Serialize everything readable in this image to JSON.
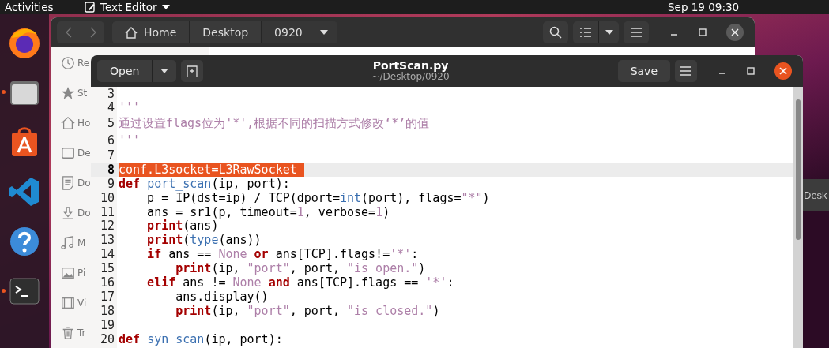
{
  "top_bar": {
    "activities": "Activities",
    "app_menu": "Text Editor",
    "clock": "Sep 19  09:30"
  },
  "dock": [
    {
      "kind": "browser",
      "running": false
    },
    {
      "kind": "files",
      "running": true
    },
    {
      "kind": "software",
      "running": false
    },
    {
      "kind": "code",
      "running": false
    },
    {
      "kind": "help",
      "running": false
    },
    {
      "kind": "terminal",
      "running": true
    }
  ],
  "file_manager": {
    "path": [
      {
        "label": "Home",
        "kind": "home",
        "selected": false
      },
      {
        "label": "Desktop",
        "kind": "folder",
        "selected": false
      },
      {
        "label": "0920",
        "kind": "folder",
        "selected": true
      }
    ],
    "sidebar": [
      {
        "label": "Re",
        "kind": "recent"
      },
      {
        "label": "St",
        "kind": "starred"
      },
      {
        "label": "Ho",
        "kind": "home"
      },
      {
        "label": "De",
        "kind": "desktop"
      },
      {
        "label": "Do",
        "kind": "documents"
      },
      {
        "label": "Do",
        "kind": "downloads"
      },
      {
        "label": "M",
        "kind": "music"
      },
      {
        "label": "Pi",
        "kind": "pictures"
      },
      {
        "label": "Vi",
        "kind": "videos"
      },
      {
        "label": "Tr",
        "kind": "trash"
      }
    ]
  },
  "editor": {
    "open_button": "Open",
    "title": "PortScan.py",
    "subtitle": "~/Desktop/0920",
    "save_button": "Save",
    "lines": [
      {
        "n": "3",
        "current": false
      },
      {
        "n": "4",
        "current": false,
        "tokens": [
          {
            "text": "'''",
            "kind": "string"
          }
        ]
      },
      {
        "n": "5",
        "current": false,
        "tokens": [
          {
            "text": "通过设置flags位为'*',根据不同的扫描方式修改‘*’的值",
            "kind": "string"
          }
        ]
      },
      {
        "n": "6",
        "current": false,
        "tokens": [
          {
            "text": "'''",
            "kind": "string"
          }
        ]
      },
      {
        "n": "7",
        "current": false
      },
      {
        "n": "8",
        "current": true,
        "tokens": [
          {
            "text": "conf.L3socket=L3RawSocket ",
            "kind": "selected"
          }
        ]
      },
      {
        "n": "9",
        "current": false,
        "tokens": [
          {
            "text": "def ",
            "kind": "keyword"
          },
          {
            "text": "port_scan",
            "kind": "function"
          },
          {
            "text": "(ip, port):",
            "kind": "plain"
          }
        ]
      },
      {
        "n": "10",
        "current": false,
        "tokens": [
          {
            "text": "    p = IP(dst=ip) / TCP(dport=",
            "kind": "plain"
          },
          {
            "text": "int",
            "kind": "builtin"
          },
          {
            "text": "(port), flags=",
            "kind": "plain"
          },
          {
            "text": "\"*\"",
            "kind": "string"
          },
          {
            "text": ")",
            "kind": "plain"
          }
        ]
      },
      {
        "n": "11",
        "current": false,
        "tokens": [
          {
            "text": "    ans = sr1(p, timeout=",
            "kind": "plain"
          },
          {
            "text": "1",
            "kind": "number"
          },
          {
            "text": ", verbose=",
            "kind": "plain"
          },
          {
            "text": "1",
            "kind": "number"
          },
          {
            "text": ")",
            "kind": "plain"
          }
        ]
      },
      {
        "n": "12",
        "current": false,
        "tokens": [
          {
            "text": "    print",
            "kind": "keyword"
          },
          {
            "text": "(ans)",
            "kind": "plain"
          }
        ]
      },
      {
        "n": "13",
        "current": false,
        "tokens": [
          {
            "text": "    print",
            "kind": "keyword"
          },
          {
            "text": "(",
            "kind": "plain"
          },
          {
            "text": "type",
            "kind": "builtin"
          },
          {
            "text": "(ans))",
            "kind": "plain"
          }
        ]
      },
      {
        "n": "14",
        "current": false,
        "tokens": [
          {
            "text": "    if",
            "kind": "keyword"
          },
          {
            "text": " ans == ",
            "kind": "plain"
          },
          {
            "text": "None",
            "kind": "number"
          },
          {
            "text": " or",
            "kind": "keyword"
          },
          {
            "text": " ans[TCP].flags!=",
            "kind": "plain"
          },
          {
            "text": "'*'",
            "kind": "string"
          },
          {
            "text": ":",
            "kind": "plain"
          }
        ]
      },
      {
        "n": "15",
        "current": false,
        "tokens": [
          {
            "text": "        print",
            "kind": "keyword"
          },
          {
            "text": "(ip, ",
            "kind": "plain"
          },
          {
            "text": "\"port\"",
            "kind": "string"
          },
          {
            "text": ", port, ",
            "kind": "plain"
          },
          {
            "text": "\"is open.\"",
            "kind": "string"
          },
          {
            "text": ")",
            "kind": "plain"
          }
        ]
      },
      {
        "n": "16",
        "current": false,
        "tokens": [
          {
            "text": "    elif",
            "kind": "keyword"
          },
          {
            "text": " ans != ",
            "kind": "plain"
          },
          {
            "text": "None",
            "kind": "number"
          },
          {
            "text": " and",
            "kind": "keyword"
          },
          {
            "text": " ans[TCP].flags == ",
            "kind": "plain"
          },
          {
            "text": "'*'",
            "kind": "string"
          },
          {
            "text": ":",
            "kind": "plain"
          }
        ]
      },
      {
        "n": "17",
        "current": false,
        "tokens": [
          {
            "text": "        ans.display()",
            "kind": "plain"
          }
        ]
      },
      {
        "n": "18",
        "current": false,
        "tokens": [
          {
            "text": "        print",
            "kind": "keyword"
          },
          {
            "text": "(ip, ",
            "kind": "plain"
          },
          {
            "text": "\"port\"",
            "kind": "string"
          },
          {
            "text": ", port, ",
            "kind": "plain"
          },
          {
            "text": "\"is closed.\"",
            "kind": "string"
          },
          {
            "text": ")",
            "kind": "plain"
          }
        ]
      },
      {
        "n": "19",
        "current": false
      },
      {
        "n": "20",
        "current": false,
        "tokens": [
          {
            "text": "def ",
            "kind": "keyword"
          },
          {
            "text": "syn_scan",
            "kind": "function"
          },
          {
            "text": "(ip, port):",
            "kind": "plain"
          }
        ]
      }
    ]
  },
  "background_window": {
    "label": "Desk"
  }
}
